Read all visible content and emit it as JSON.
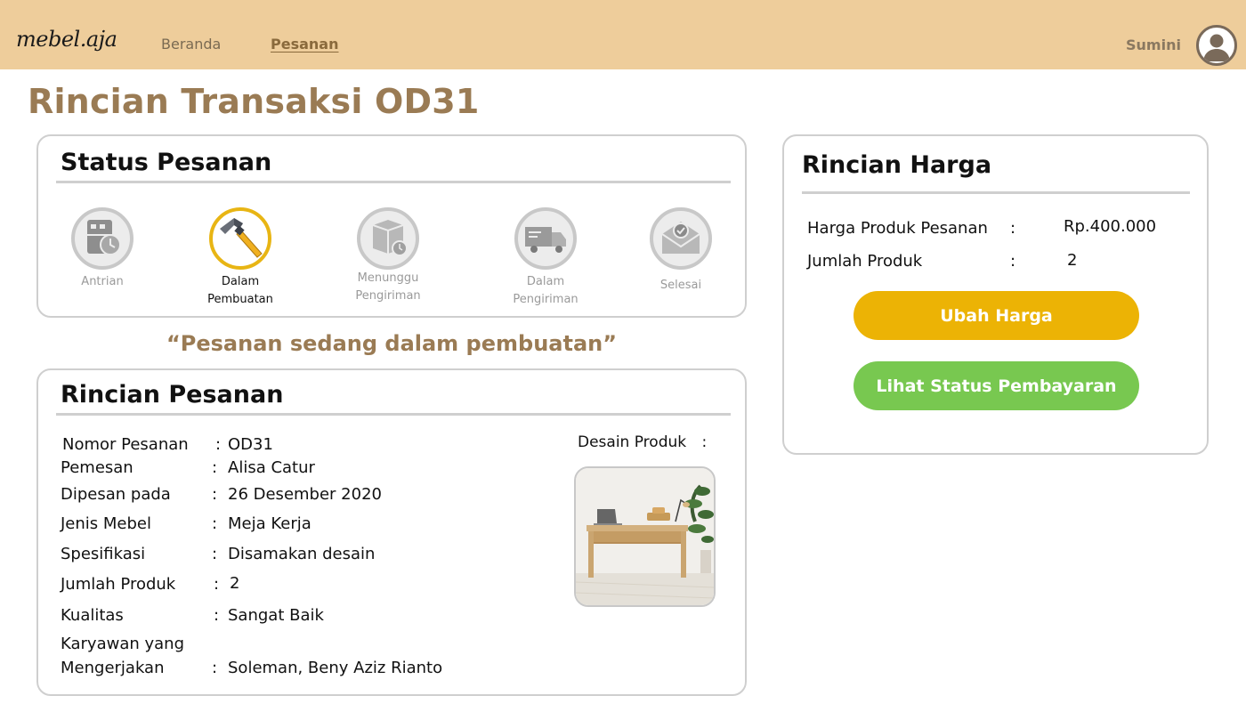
{
  "header": {
    "logo": "mebel.aja",
    "nav": [
      {
        "label": "Beranda"
      },
      {
        "label": "Pesanan"
      }
    ],
    "username": "Sumini"
  },
  "page": {
    "title": "Rincian Transaksi OD31"
  },
  "status": {
    "title": "Status Pesanan",
    "steps": [
      {
        "label_line1": "Antrian",
        "label_line2": "",
        "icon": "queue-icon",
        "active": false
      },
      {
        "label_line1": "Dalam",
        "label_line2": "Pembuatan",
        "icon": "hammer-icon",
        "active": true
      },
      {
        "label_line1": "Menunggu",
        "label_line2": "Pengiriman",
        "icon": "package-wait-icon",
        "active": false
      },
      {
        "label_line1": "Dalam",
        "label_line2": "Pengiriman",
        "icon": "truck-icon",
        "active": false
      },
      {
        "label_line1": "Selesai",
        "label_line2": "",
        "icon": "envelope-check-icon",
        "active": false
      }
    ],
    "caption": "“Pesanan sedang dalam pembuatan”"
  },
  "order": {
    "title": "Rincian Pesanan",
    "rows": [
      {
        "label": "Nomor Pesanan",
        "value": "OD31"
      },
      {
        "label": "Pemesan",
        "value": "Alisa Catur"
      },
      {
        "label": "Dipesan pada",
        "value": "26 Desember 2020"
      },
      {
        "label": "Jenis Mebel",
        "value": "Meja Kerja"
      },
      {
        "label": "Spesifikasi",
        "value": "Disamakan desain"
      },
      {
        "label": "Jumlah Produk",
        "value": "2"
      },
      {
        "label": "Kualitas",
        "value": "Sangat Baik"
      },
      {
        "label_line1": "Karyawan yang",
        "label_line2": "Mengerjakan",
        "value": "Soleman, Beny Aziz Rianto"
      }
    ],
    "design_label": "Desain Produk",
    "colon": ":"
  },
  "price": {
    "title": "Rincian Harga",
    "rows": [
      {
        "label": "Harga Produk Pesanan",
        "value": "Rp.400.000"
      },
      {
        "label": "Jumlah Produk",
        "value": "2"
      }
    ],
    "edit_button": "Ubah Harga",
    "payment_button": "Lihat Status Pembayaran"
  },
  "colors": {
    "header_bg": "#eecd9b",
    "accent_brown": "#9a7b54",
    "active_ring": "#e8b514",
    "button_yellow": "#ecb305",
    "button_green": "#78c850"
  }
}
